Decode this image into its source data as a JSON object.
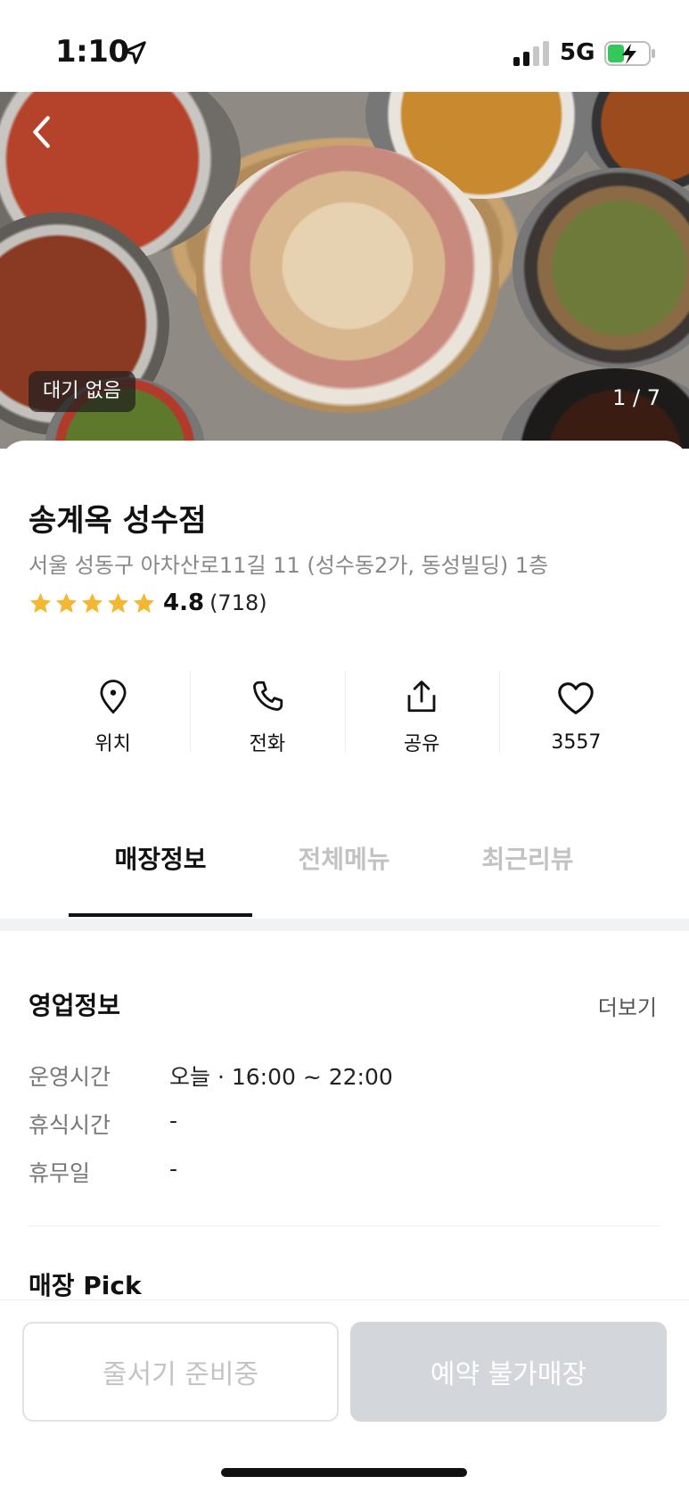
{
  "status_bar": {
    "time": "1:10",
    "network": "5G",
    "icons": [
      "location-arrow-icon",
      "signal-icon",
      "battery-charging-icon"
    ]
  },
  "hero": {
    "wait_badge": "대기 없음",
    "counter": "1 / 7",
    "back_icon": "chevron-left-icon"
  },
  "store": {
    "name": "송계옥 성수점",
    "address": "서울 성동구 아차산로11길 11 (성수동2가, 동성빌딩) 1층",
    "rating": "4.8",
    "review_count": "(718)",
    "stars": 5,
    "star_color": "#f4b731"
  },
  "actions": [
    {
      "label": "위치",
      "icon": "location-pin-icon"
    },
    {
      "label": "전화",
      "icon": "phone-icon"
    },
    {
      "label": "공유",
      "icon": "share-icon"
    },
    {
      "label": "3557",
      "icon": "heart-icon"
    }
  ],
  "tabs": [
    {
      "label": "매장정보",
      "active": true
    },
    {
      "label": "전체메뉴",
      "active": false
    },
    {
      "label": "최근리뷰",
      "active": false
    }
  ],
  "business_info": {
    "title": "영업정보",
    "more": "더보기",
    "rows": [
      {
        "label": "운영시간",
        "value": "오늘 · 16:00 ~ 22:00"
      },
      {
        "label": "휴식시간",
        "value": "-"
      },
      {
        "label": "휴무일",
        "value": "-"
      }
    ]
  },
  "pick": {
    "title": "매장 Pick"
  },
  "bottom": {
    "queue_button": "줄서기 준비중",
    "reserve_button": "예약 불가매장"
  }
}
